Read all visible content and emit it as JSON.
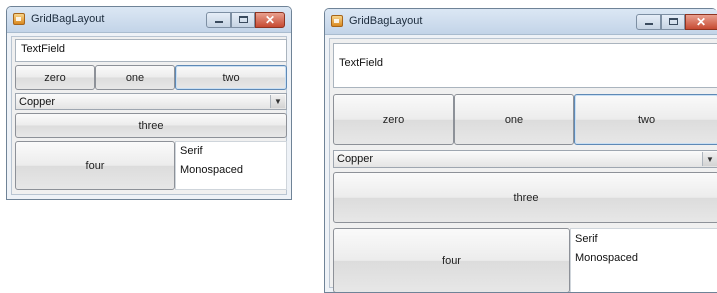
{
  "windows": [
    {
      "title": "GridBagLayout",
      "textfield": "TextField",
      "buttons": {
        "zero": "zero",
        "one": "one",
        "two": "two",
        "three": "three",
        "four": "four"
      },
      "combo": {
        "selected": "Copper"
      },
      "list": [
        "Serif",
        "Monospaced"
      ]
    },
    {
      "title": "GridBagLayout",
      "textfield": "TextField",
      "buttons": {
        "zero": "zero",
        "one": "one",
        "two": "two",
        "three": "three",
        "four": "four"
      },
      "combo": {
        "selected": "Copper"
      },
      "list": [
        "Serif",
        "Monospaced"
      ]
    }
  ],
  "colors": {
    "titlebar": "#c9d9eb",
    "close_button": "#c64a32",
    "focus_border": "#5e89b6"
  },
  "icons": [
    "app-icon",
    "minimize-icon",
    "maximize-icon",
    "close-icon",
    "dropdown-arrow-icon"
  ]
}
